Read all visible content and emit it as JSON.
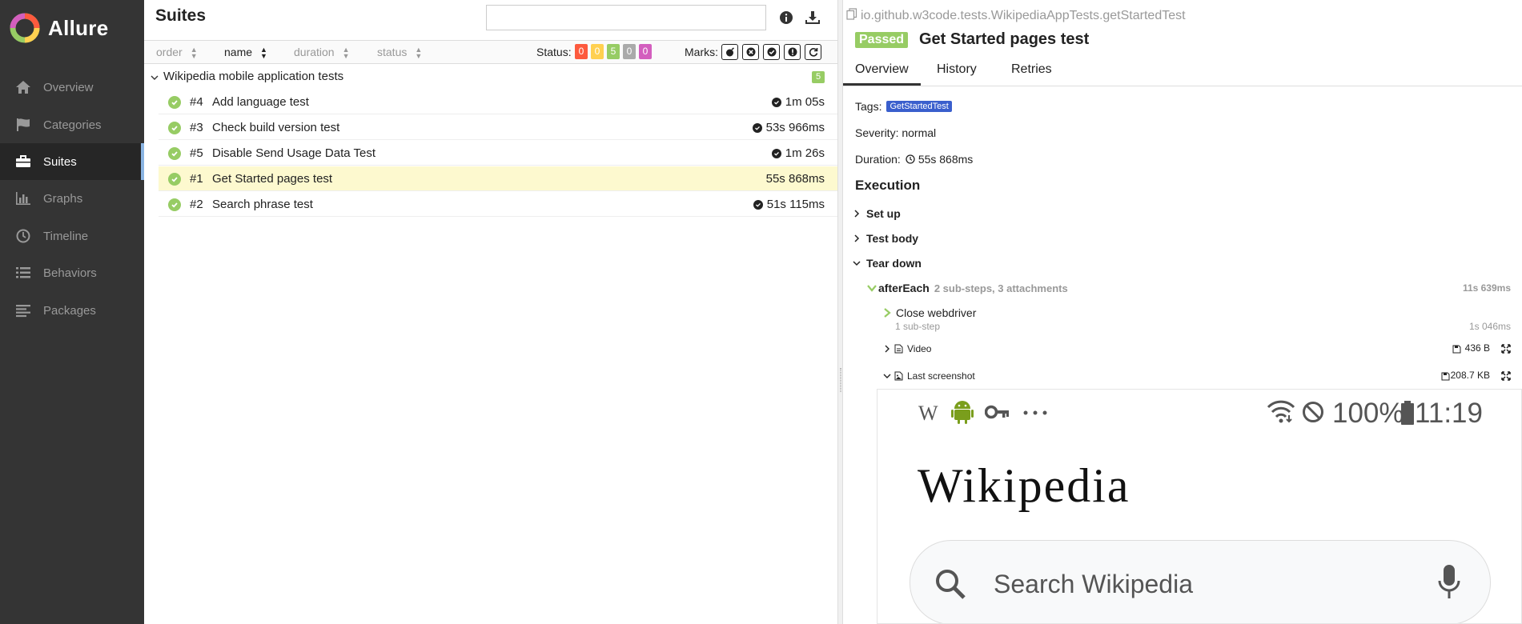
{
  "app": {
    "name": "Allure"
  },
  "sidebar": {
    "items": [
      {
        "label": "Overview",
        "icon": "home-icon"
      },
      {
        "label": "Categories",
        "icon": "flag-icon"
      },
      {
        "label": "Suites",
        "icon": "briefcase-icon",
        "active": true
      },
      {
        "label": "Graphs",
        "icon": "bar-chart-icon"
      },
      {
        "label": "Timeline",
        "icon": "clock-icon"
      },
      {
        "label": "Behaviors",
        "icon": "list-icon"
      },
      {
        "label": "Packages",
        "icon": "align-left-icon"
      }
    ]
  },
  "suites": {
    "title": "Suites",
    "search_value": "",
    "sort": {
      "order": "order",
      "name": "name",
      "duration": "duration",
      "status": "status"
    },
    "status_label": "Status:",
    "status_counts": [
      {
        "value": "0",
        "color": "#fd5a3e"
      },
      {
        "value": "0",
        "color": "#ffd050"
      },
      {
        "value": "5",
        "color": "#97cc64"
      },
      {
        "value": "0",
        "color": "#aaaaaa"
      },
      {
        "value": "0",
        "color": "#d35ebe"
      }
    ],
    "marks_label": "Marks:",
    "group": {
      "title": "Wikipedia mobile application tests",
      "count": "5"
    },
    "rows": [
      {
        "num": "#4",
        "name": "Add language test",
        "duration": "1m 05s"
      },
      {
        "num": "#3",
        "name": "Check build version test",
        "duration": "53s 966ms"
      },
      {
        "num": "#5",
        "name": "Disable Send Usage Data Test",
        "duration": "1m 26s"
      },
      {
        "num": "#1",
        "name": "Get Started pages test",
        "duration": "55s 868ms",
        "selected": true
      },
      {
        "num": "#2",
        "name": "Search phrase test",
        "duration": "51s 115ms"
      }
    ]
  },
  "detail": {
    "full_name": "io.github.w3code.tests.WikipediaAppTests.getStartedTest",
    "status": "Passed",
    "title": "Get Started pages test",
    "tabs": [
      "Overview",
      "History",
      "Retries"
    ],
    "tags_label": "Tags:",
    "tag": "GetStartedTest",
    "severity": "Severity: normal",
    "duration_label": "Duration:",
    "duration": "55s 868ms",
    "execution_title": "Execution",
    "setup": "Set up",
    "test_body": "Test body",
    "teardown": "Tear down",
    "after_each": {
      "name": "afterEach",
      "summary": "2 sub-steps, 3 attachments",
      "duration": "11s 639ms"
    },
    "close_webdriver": {
      "name": "Close webdriver",
      "sub": "1 sub-step",
      "duration": "1s 046ms"
    },
    "video": {
      "name": "Video",
      "size": "436 B"
    },
    "last_screenshot": {
      "name": "Last screenshot",
      "size": "208.7 KB"
    }
  },
  "phone": {
    "battery": "100%",
    "time": "11:19",
    "logo": "Wikipedia",
    "search_placeholder": "Search Wikipedia"
  }
}
